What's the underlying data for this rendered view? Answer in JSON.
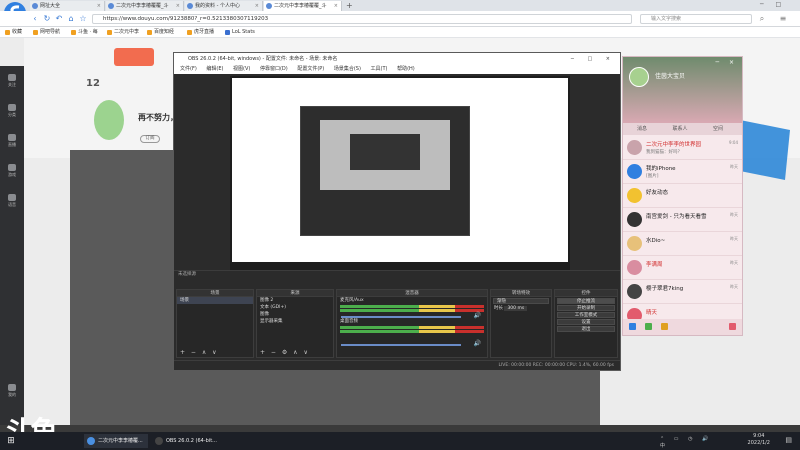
{
  "browser": {
    "tabs": [
      {
        "label": "网址大全"
      },
      {
        "label": "二次元中李李椿覆覆_斗"
      },
      {
        "label": "我的资料 - 个人中心"
      },
      {
        "label": "二次元中李李椿覆覆_斗"
      }
    ],
    "url": "https://www.douyu.com/9123880?_r=0.5213380307119203",
    "search_placeholder": "输入文字搜索",
    "bookmarks": [
      "收藏",
      "网吧导航",
      "斗鱼 · 每",
      "二次元中李",
      "百度知经",
      "虎牙直播",
      "LoL Stats"
    ]
  },
  "page": {
    "count": "12",
    "banner_text": "再不努力，二公主",
    "follow_label": "订阅",
    "left_sidebar": [
      "关注",
      "分类",
      "直播",
      "游戏",
      "语音",
      "我的"
    ]
  },
  "obs": {
    "title": "OBS 26.0.2 (64-bit, windows) - 配置文件: 未命名 - 场景: 未命名",
    "menu": [
      "文件(F)",
      "编辑(E)",
      "视图(V)",
      "停靠窗口(D)",
      "配置文件(P)",
      "场景集合(S)",
      "工具(T)",
      "帮助(H)"
    ],
    "preview_bar": "未选择源",
    "docks": {
      "scenes": {
        "header": "场景",
        "items": [
          "场景"
        ],
        "footer": "+ − ∧ ∨"
      },
      "sources": {
        "header": "来源",
        "items": [
          "图像 2",
          "文本 (GDI+)",
          "图像",
          "显示器采集"
        ],
        "footer": "+ − ⚙ ∧ ∨"
      },
      "mixer": {
        "header": "混音器",
        "channels": [
          "桌面音频",
          "麦克风/Aux"
        ]
      },
      "transitions": {
        "header": "转场特效",
        "mode": "渐隐",
        "duration_label": "时长",
        "duration": "300 ms"
      },
      "controls": {
        "header": "控件",
        "buttons": [
          "停止推流",
          "开始录制",
          "工作室模式",
          "设置",
          "退出"
        ]
      }
    },
    "status": "LIVE: 00:00:00   REC: 00:00:00   CPU: 1.4%, 60.00 fps"
  },
  "qq": {
    "username": "佳茵大宝贝",
    "tabs": [
      "消息",
      "联系人",
      "空间"
    ],
    "conversations": [
      {
        "name": "二次元中李李的世界园",
        "msg": "我到猫猫：好吗？",
        "time": "9:04",
        "red": true
      },
      {
        "name": "我的iPhone",
        "msg": "[图片]",
        "time": "昨天",
        "red": false
      },
      {
        "name": "好友动态",
        "msg": "",
        "time": "",
        "red": false
      },
      {
        "name": "南宫爱剑 - 只为看天看雪",
        "msg": "",
        "time": "昨天",
        "red": false
      },
      {
        "name": "水Dio~",
        "msg": "",
        "time": "昨天",
        "red": false
      },
      {
        "name": "李满周",
        "msg": "",
        "time": "昨天",
        "red": true
      },
      {
        "name": "樱子翠君7king",
        "msg": "",
        "time": "昨天",
        "red": false
      },
      {
        "name": "晴天",
        "msg": "",
        "time": "",
        "red": true
      }
    ]
  },
  "taskbar": {
    "items": [
      "二次元中李李椿覆...",
      "OBS 26.0.2 (64-bit..."
    ],
    "time": "9:04",
    "date": "2022/1/2"
  },
  "watermark": "斗鱼"
}
